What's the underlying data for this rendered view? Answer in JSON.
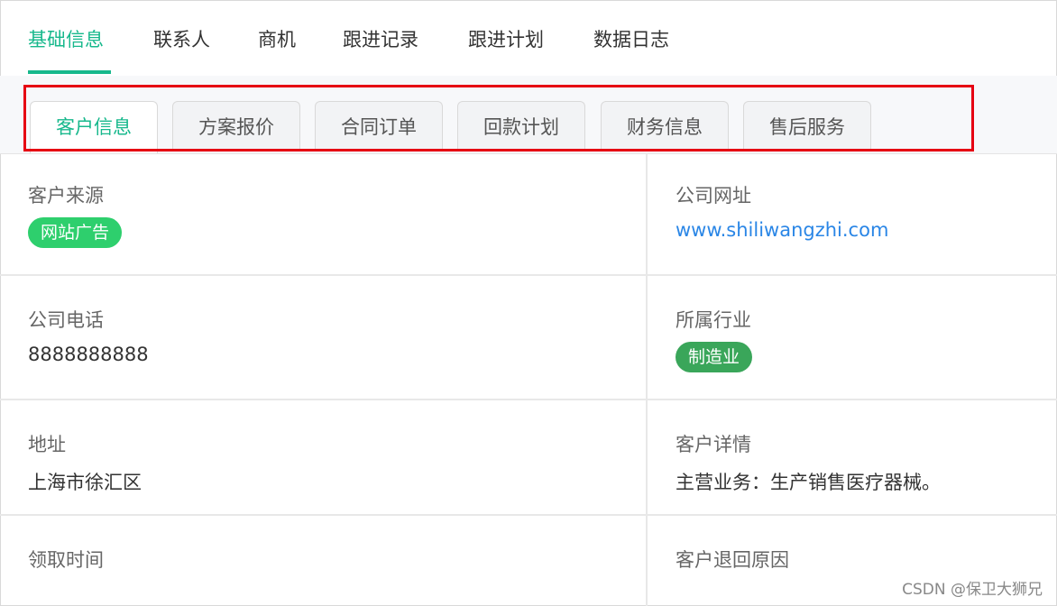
{
  "top_tabs": {
    "items": [
      {
        "label": "基础信息",
        "active": true
      },
      {
        "label": "联系人",
        "active": false
      },
      {
        "label": "商机",
        "active": false
      },
      {
        "label": "跟进记录",
        "active": false
      },
      {
        "label": "跟进计划",
        "active": false
      },
      {
        "label": "数据日志",
        "active": false
      }
    ],
    "accent_color": "#17b88c"
  },
  "sub_tabs": {
    "items": [
      {
        "label": "客户信息",
        "active": true
      },
      {
        "label": "方案报价",
        "active": false
      },
      {
        "label": "合同订单",
        "active": false
      },
      {
        "label": "回款计划",
        "active": false
      },
      {
        "label": "财务信息",
        "active": false
      },
      {
        "label": "售后服务",
        "active": false
      }
    ],
    "highlight_color": "#e60012"
  },
  "fields": {
    "customer_source": {
      "label": "客户来源",
      "tag": "网站广告",
      "tag_color": "#2ecf6d"
    },
    "company_website": {
      "label": "公司网址",
      "value": "www.shiliwangzhi.com",
      "link_color": "#2a86e6"
    },
    "company_phone": {
      "label": "公司电话",
      "value": "8888888888"
    },
    "industry": {
      "label": "所属行业",
      "tag": "制造业",
      "tag_color": "#3aa65a"
    },
    "address": {
      "label": "地址",
      "value": "上海市徐汇区"
    },
    "customer_details": {
      "label": "客户详情",
      "value": "主营业务：生产销售医疗器械。"
    },
    "claim_time": {
      "label": "领取时间",
      "value": ""
    },
    "return_reason": {
      "label": "客户退回原因",
      "value": ""
    }
  },
  "watermark": "CSDN @保卫大狮兄"
}
